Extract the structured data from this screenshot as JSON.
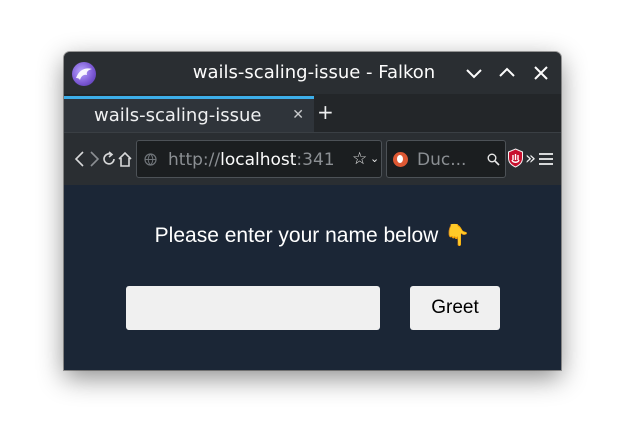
{
  "window": {
    "title": "wails-scaling-issue - Falkon",
    "app_icon": "falkon-logo-icon",
    "controls": [
      "minimize-icon",
      "maximize-icon",
      "close-icon"
    ]
  },
  "tabs": [
    {
      "label": "wails-scaling-issue",
      "active": true,
      "close_glyph": "✕"
    }
  ],
  "new_tab_glyph": "+",
  "toolbar": {
    "icons": [
      "back-icon",
      "forward-icon",
      "reload-icon",
      "home-icon"
    ],
    "url": {
      "scheme": "http://",
      "host": "localhost",
      "port": ":341",
      "star_glyph": "☆",
      "caret_glyph": "⌄"
    },
    "search": {
      "engine_icon": "duckduckgo-icon",
      "placeholder": "Duc..."
    },
    "extra_icons": [
      "adblock-icon",
      "overflow-chevrons-icon",
      "hamburger-menu-icon"
    ],
    "more_glyph": "»"
  },
  "content": {
    "prompt": "Please enter your name below 👇",
    "name_value": "",
    "greet_label": "Greet",
    "background": "#1b2636"
  }
}
